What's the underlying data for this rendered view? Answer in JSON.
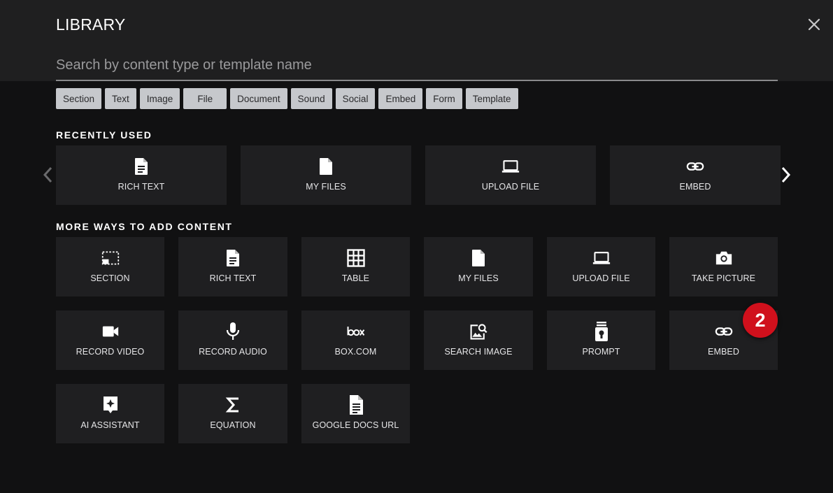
{
  "header": {
    "title": "LIBRARY",
    "search_placeholder": "Search by content type or template name",
    "filters": [
      "Section",
      "Text",
      "Image",
      "File",
      "Document",
      "Sound",
      "Social",
      "Embed",
      "Form",
      "Template"
    ]
  },
  "recently_used": {
    "heading": "RECENTLY USED",
    "items": [
      {
        "label": "RICH TEXT",
        "icon": "document-text-icon"
      },
      {
        "label": "MY FILES",
        "icon": "file-icon"
      },
      {
        "label": "UPLOAD FILE",
        "icon": "laptop-icon"
      },
      {
        "label": "EMBED",
        "icon": "link-icon"
      }
    ]
  },
  "more_ways": {
    "heading": "MORE WAYS TO ADD CONTENT",
    "items": [
      {
        "label": "SECTION",
        "icon": "section-icon"
      },
      {
        "label": "RICH TEXT",
        "icon": "document-text-icon"
      },
      {
        "label": "TABLE",
        "icon": "table-icon"
      },
      {
        "label": "MY FILES",
        "icon": "file-icon"
      },
      {
        "label": "UPLOAD FILE",
        "icon": "laptop-icon"
      },
      {
        "label": "TAKE PICTURE",
        "icon": "camera-icon"
      },
      {
        "label": "RECORD VIDEO",
        "icon": "video-camera-icon"
      },
      {
        "label": "RECORD AUDIO",
        "icon": "microphone-icon"
      },
      {
        "label": "BOX.COM",
        "icon": "box-logo-icon"
      },
      {
        "label": "SEARCH IMAGE",
        "icon": "image-search-icon"
      },
      {
        "label": "PROMPT",
        "icon": "prompt-icon"
      },
      {
        "label": "EMBED",
        "icon": "link-icon"
      },
      {
        "label": "AI ASSISTANT",
        "icon": "ai-sparkle-icon"
      },
      {
        "label": "EQUATION",
        "icon": "sigma-icon"
      },
      {
        "label": "GOOGLE DOCS URL",
        "icon": "google-doc-icon"
      }
    ]
  },
  "annotation_badge": "2",
  "colors": {
    "background": "#111112",
    "header": "#1f1f20",
    "tile": "#1f1f21",
    "chip": "#c6c8cc",
    "badge": "#d0101c"
  }
}
